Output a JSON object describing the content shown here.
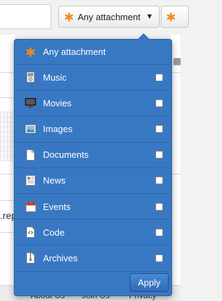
{
  "filter_button": {
    "label": "Any attachment",
    "icon": "asterisk-icon"
  },
  "background": {
    "partial_text": ".rep"
  },
  "footer": {
    "links": [
      "About Us",
      "Join Us",
      "Privacy"
    ]
  },
  "dropdown": {
    "items": [
      {
        "label": "Any attachment",
        "icon": "asterisk-icon",
        "checkbox": false
      },
      {
        "label": "Music",
        "icon": "music-player-icon",
        "checkbox": true,
        "checked": false
      },
      {
        "label": "Movies",
        "icon": "monitor-icon",
        "checkbox": true,
        "checked": false
      },
      {
        "label": "Images",
        "icon": "image-icon",
        "checkbox": true,
        "checked": false
      },
      {
        "label": "Documents",
        "icon": "document-icon",
        "checkbox": true,
        "checked": false
      },
      {
        "label": "News",
        "icon": "newspaper-icon",
        "checkbox": true,
        "checked": false
      },
      {
        "label": "Events",
        "icon": "calendar-icon",
        "checkbox": true,
        "checked": false
      },
      {
        "label": "Code",
        "icon": "code-file-icon",
        "checkbox": true,
        "checked": false
      },
      {
        "label": "Archives",
        "icon": "archive-icon",
        "checkbox": true,
        "checked": false
      }
    ],
    "apply_label": "Apply"
  },
  "colors": {
    "dropdown_bg": "#3878c3",
    "asterisk_orange": "#f08a1e"
  }
}
